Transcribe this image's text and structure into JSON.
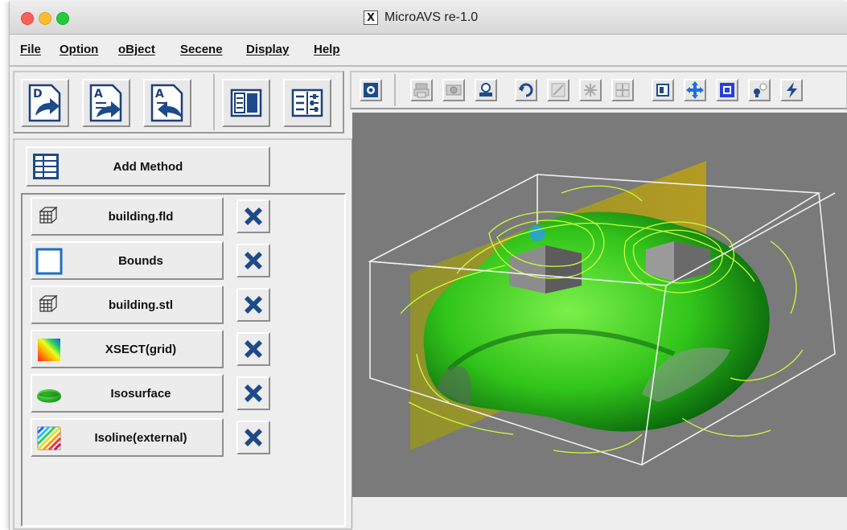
{
  "window": {
    "title": "MicroAVS re-1.0",
    "title_icon": "X"
  },
  "menu": [
    {
      "label": "File"
    },
    {
      "label": "Option"
    },
    {
      "label": "oBject"
    },
    {
      "label": "Secene"
    },
    {
      "label": "Display"
    },
    {
      "label": "Help"
    }
  ],
  "left_toolbar": {
    "buttons": [
      {
        "name": "data-open-icon",
        "letter": "D"
      },
      {
        "name": "append-data-icon",
        "letter": "A"
      },
      {
        "name": "append-data-alt-icon",
        "letter": "A"
      },
      {
        "name": "two-panel-layout-icon",
        "letter": ""
      },
      {
        "name": "panel-settings-icon",
        "letter": ""
      }
    ]
  },
  "add_method": {
    "label": "Add Method"
  },
  "methods": [
    {
      "label": "building.fld",
      "icon": "grid-cube-icon"
    },
    {
      "label": "Bounds",
      "icon": "bounds-box-icon"
    },
    {
      "label": "building.stl",
      "icon": "grid-cube-icon"
    },
    {
      "label": "XSECT(grid)",
      "icon": "color-slice-icon"
    },
    {
      "label": "Isosurface",
      "icon": "isosurface-icon"
    },
    {
      "label": "Isoline(external)",
      "icon": "isoline-icon"
    }
  ],
  "right_toolbar": {
    "icons": [
      "camera-reset-icon",
      "print-icon",
      "snapshot-icon",
      "record-icon",
      "rotate-icon",
      "panel-icon",
      "expand-icon",
      "shrink-icon",
      "mask-icon",
      "move-icon",
      "frame-icon",
      "light-icon",
      "flash-icon"
    ]
  },
  "colors": {
    "viewer_background": "#7a7a7a",
    "isosurface": "#2fcf1c",
    "contour": "#c8ff3a",
    "slice": "#b9a400",
    "delete_x": "#1d4a8a"
  }
}
